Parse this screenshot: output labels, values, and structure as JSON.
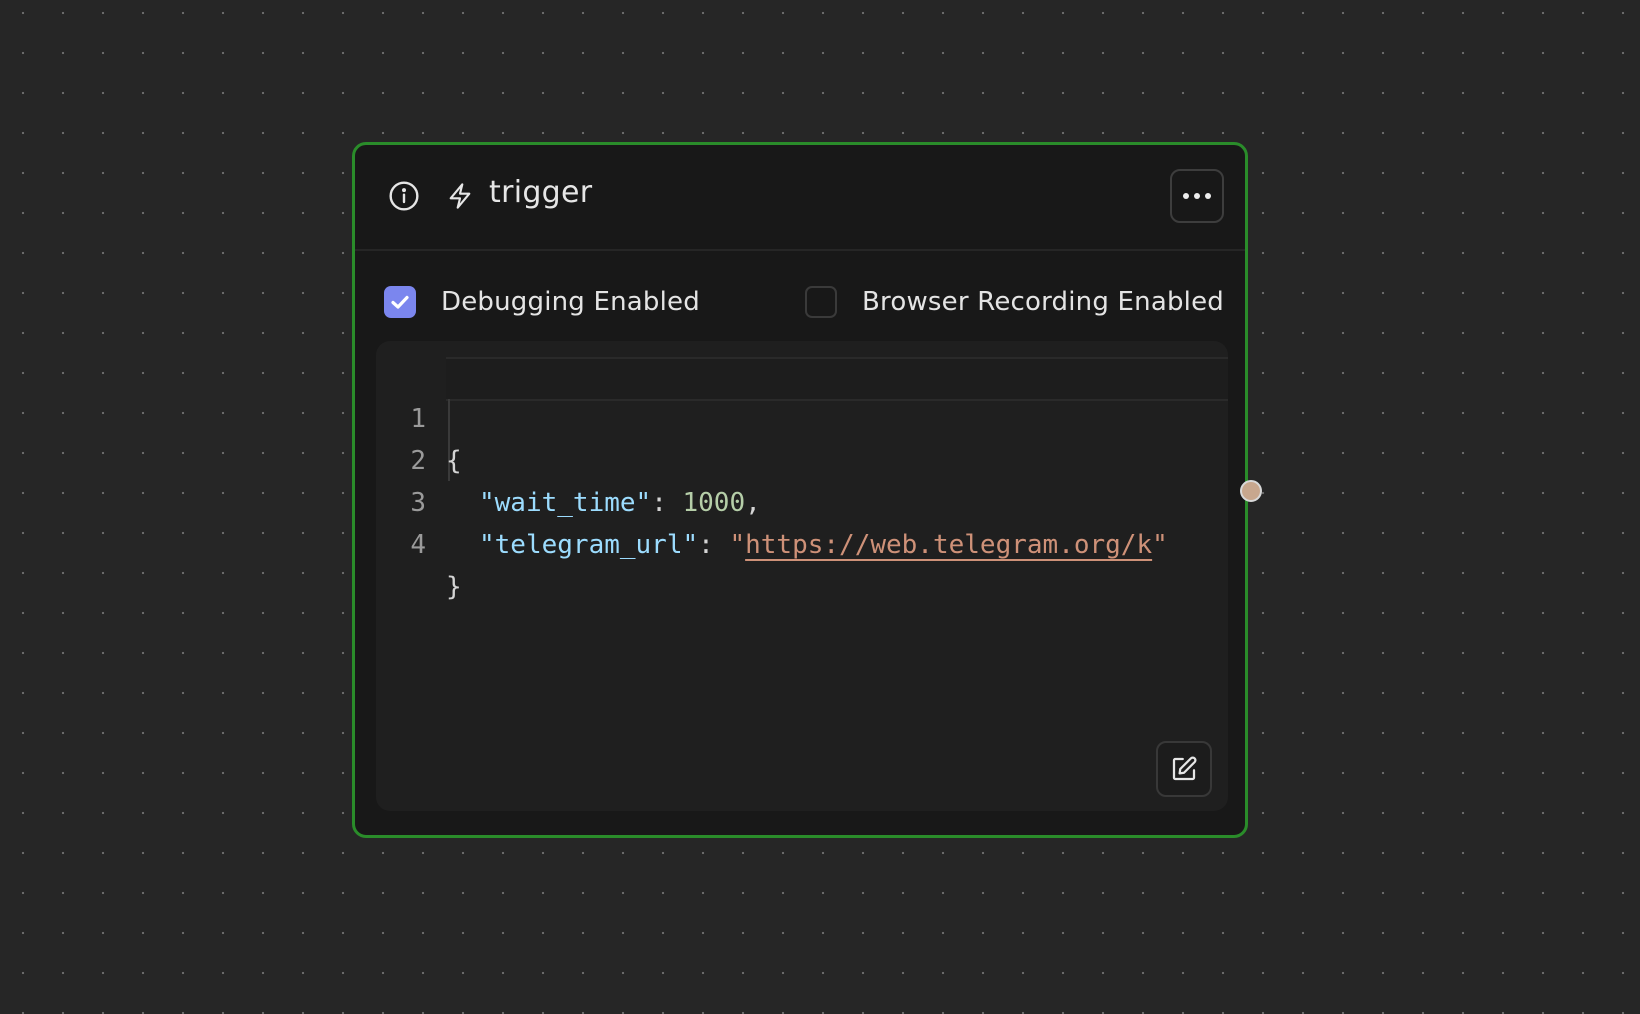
{
  "node": {
    "title": "trigger",
    "icons": {
      "info": "info-icon",
      "type": "lightning-bolt-icon",
      "more": "more-horizontal-icon",
      "edit": "edit-icon"
    },
    "border_color": "#2a8c2a",
    "options": [
      {
        "label": "Debugging Enabled",
        "checked": true
      },
      {
        "label": "Browser Recording Enabled",
        "checked": false
      }
    ],
    "editor": {
      "lines": [
        {
          "number": "1",
          "text": "{"
        },
        {
          "number": "2",
          "key": "\"wait_time\"",
          "sep": ": ",
          "value": "1000",
          "trail": ","
        },
        {
          "number": "3",
          "key": "\"telegram_url\"",
          "sep": ": ",
          "quote_open": "\"",
          "value": "https://web.telegram.org/k",
          "quote_close": "\""
        },
        {
          "number": "4",
          "text": "}"
        }
      ]
    },
    "checkbox_accent": "#7b86ee"
  }
}
